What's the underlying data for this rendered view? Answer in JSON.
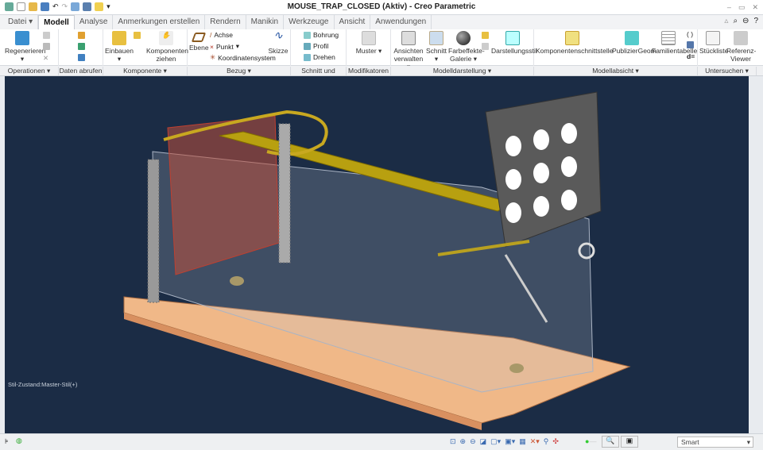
{
  "window": {
    "title": "MOUSE_TRAP_CLOSED (Aktiv) - Creo Parametric"
  },
  "tabs": [
    "Datei",
    "Modell",
    "Analyse",
    "Anmerkungen erstellen",
    "Rendern",
    "Manikin",
    "Werkzeuge",
    "Ansicht",
    "Anwendungen"
  ],
  "active_tab": "Modell",
  "ribbon": {
    "regenerieren": "Regenerieren",
    "einbauen": "Einbauen",
    "komponenten_ziehen": "Komponenten ziehen",
    "ebene": "Ebene",
    "achse": "Achse",
    "punkt": "Punkt",
    "koordinatensystem": "Koordinatensystem",
    "skizze": "Skizze",
    "bohrung": "Bohrung",
    "profil": "Profil",
    "drehen": "Drehen",
    "muster": "Muster",
    "ansichten_verwalten": "Ansichten verwalten",
    "schnitt": "Schnitt",
    "farbeffekte": "Farbeffekte-Galerie",
    "darstellungsstil": "Darstellungsstil",
    "komponentenschnittstelle": "Komponentenschnittstelle",
    "publiziergeom": "PublizierGeom",
    "familientabelle": "Familientabelle",
    "d_eq": "d=",
    "stueckliste": "Stückliste",
    "referenz_viewer": "Referenz-Viewer"
  },
  "groups": [
    "Operationen",
    "Daten abrufen",
    "Komponente",
    "Bezug",
    "Schnitt und Fläche",
    "Modifikatoren",
    "Modelldarstellung",
    "Modellabsicht",
    "Untersuchen"
  ],
  "viewport": {
    "status_text": "Stil-Zustand:Master-Stil(+)",
    "background": "#1b2c45"
  },
  "statusbar": {
    "filter_value": "Smart"
  }
}
